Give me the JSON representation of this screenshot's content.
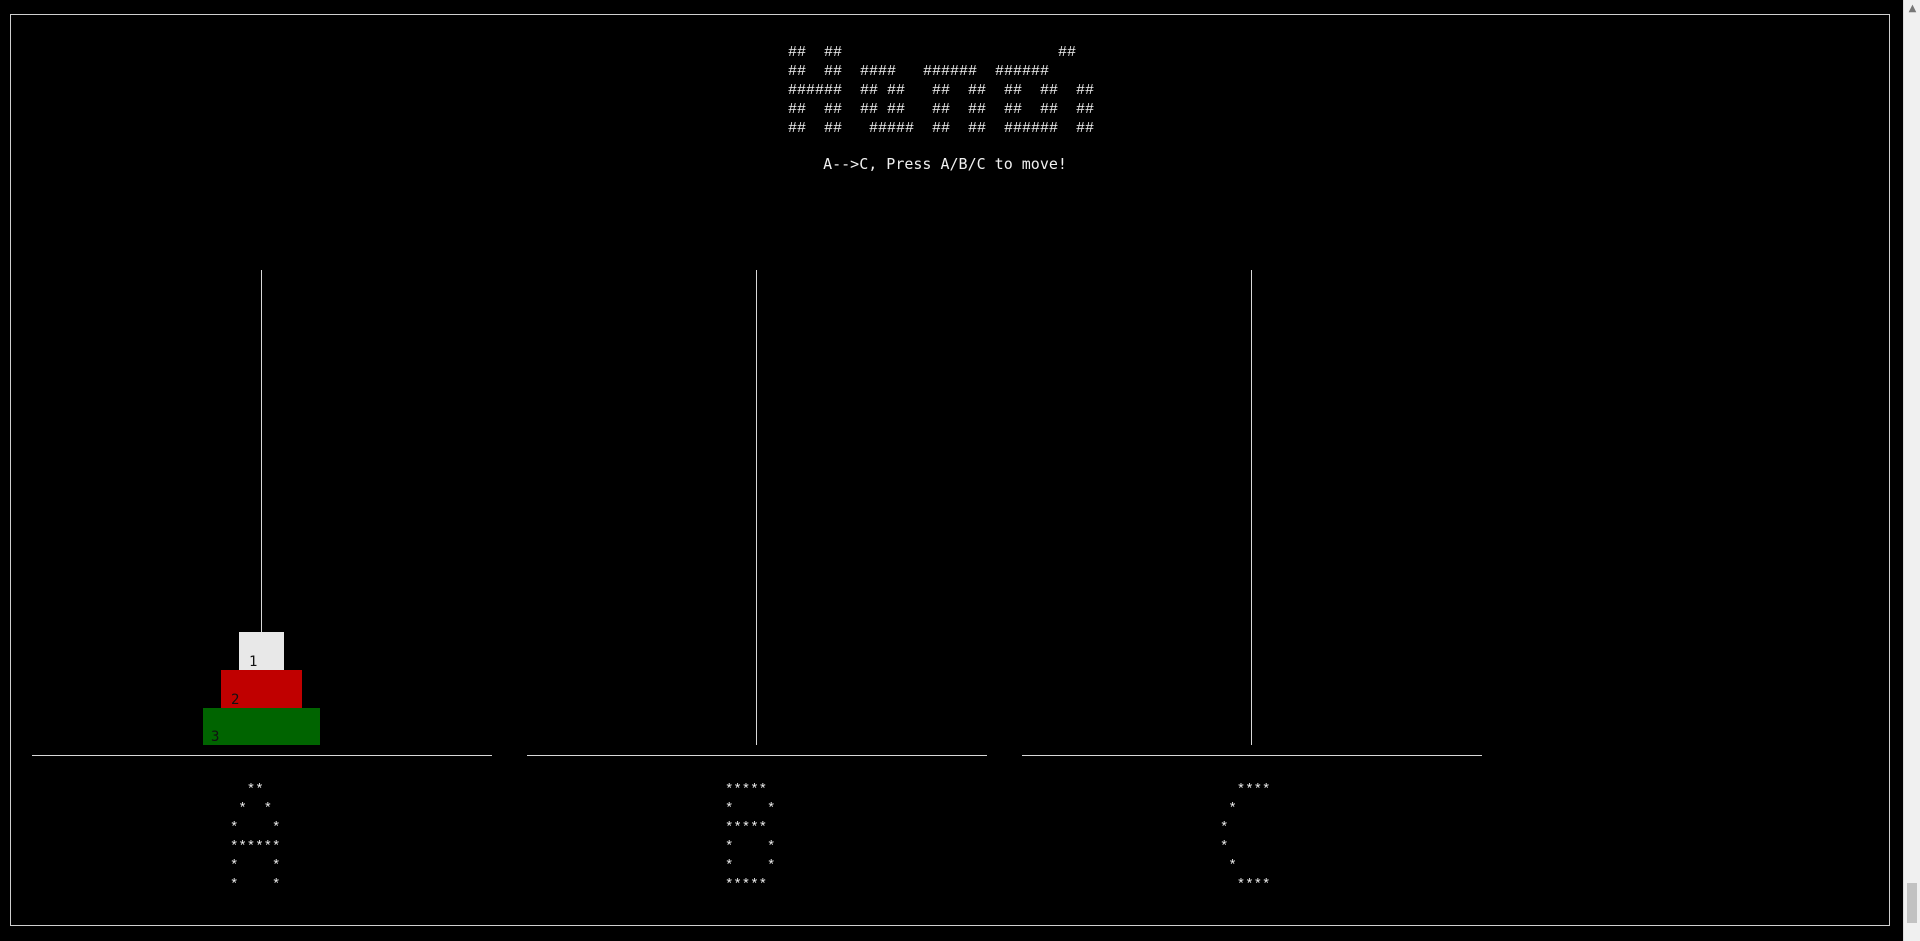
{
  "banner": {
    "lines": [
      "##  ##                        ##",
      "##  ##  ####   ######  ######",
      "######  ## ##   ##  ##  ##  ##  ##",
      "##  ##  ## ##   ##  ##  ##  ##  ##",
      "##  ##   #####  ##  ##  ######  ##"
    ]
  },
  "instruction": "A-->C, Press A/B/C to move!",
  "rods": [
    {
      "id": "A",
      "label_art": "  **\n *  *\n*    *\n******\n*    *\n*    *",
      "disks": [
        {
          "label": "1",
          "color": "#e8e8e8"
        },
        {
          "label": "2",
          "color": "#c00000"
        },
        {
          "label": "3",
          "color": "#006400"
        }
      ]
    },
    {
      "id": "B",
      "label_art": "*****\n*    *\n*****\n*    *\n*    *\n*****",
      "disks": []
    },
    {
      "id": "C",
      "label_art": "  ****\n *\n*\n*\n *\n  ****",
      "disks": []
    }
  ],
  "colors": {
    "background": "#000000",
    "text": "#f0f0f0",
    "rod": "#d8d8d8"
  }
}
